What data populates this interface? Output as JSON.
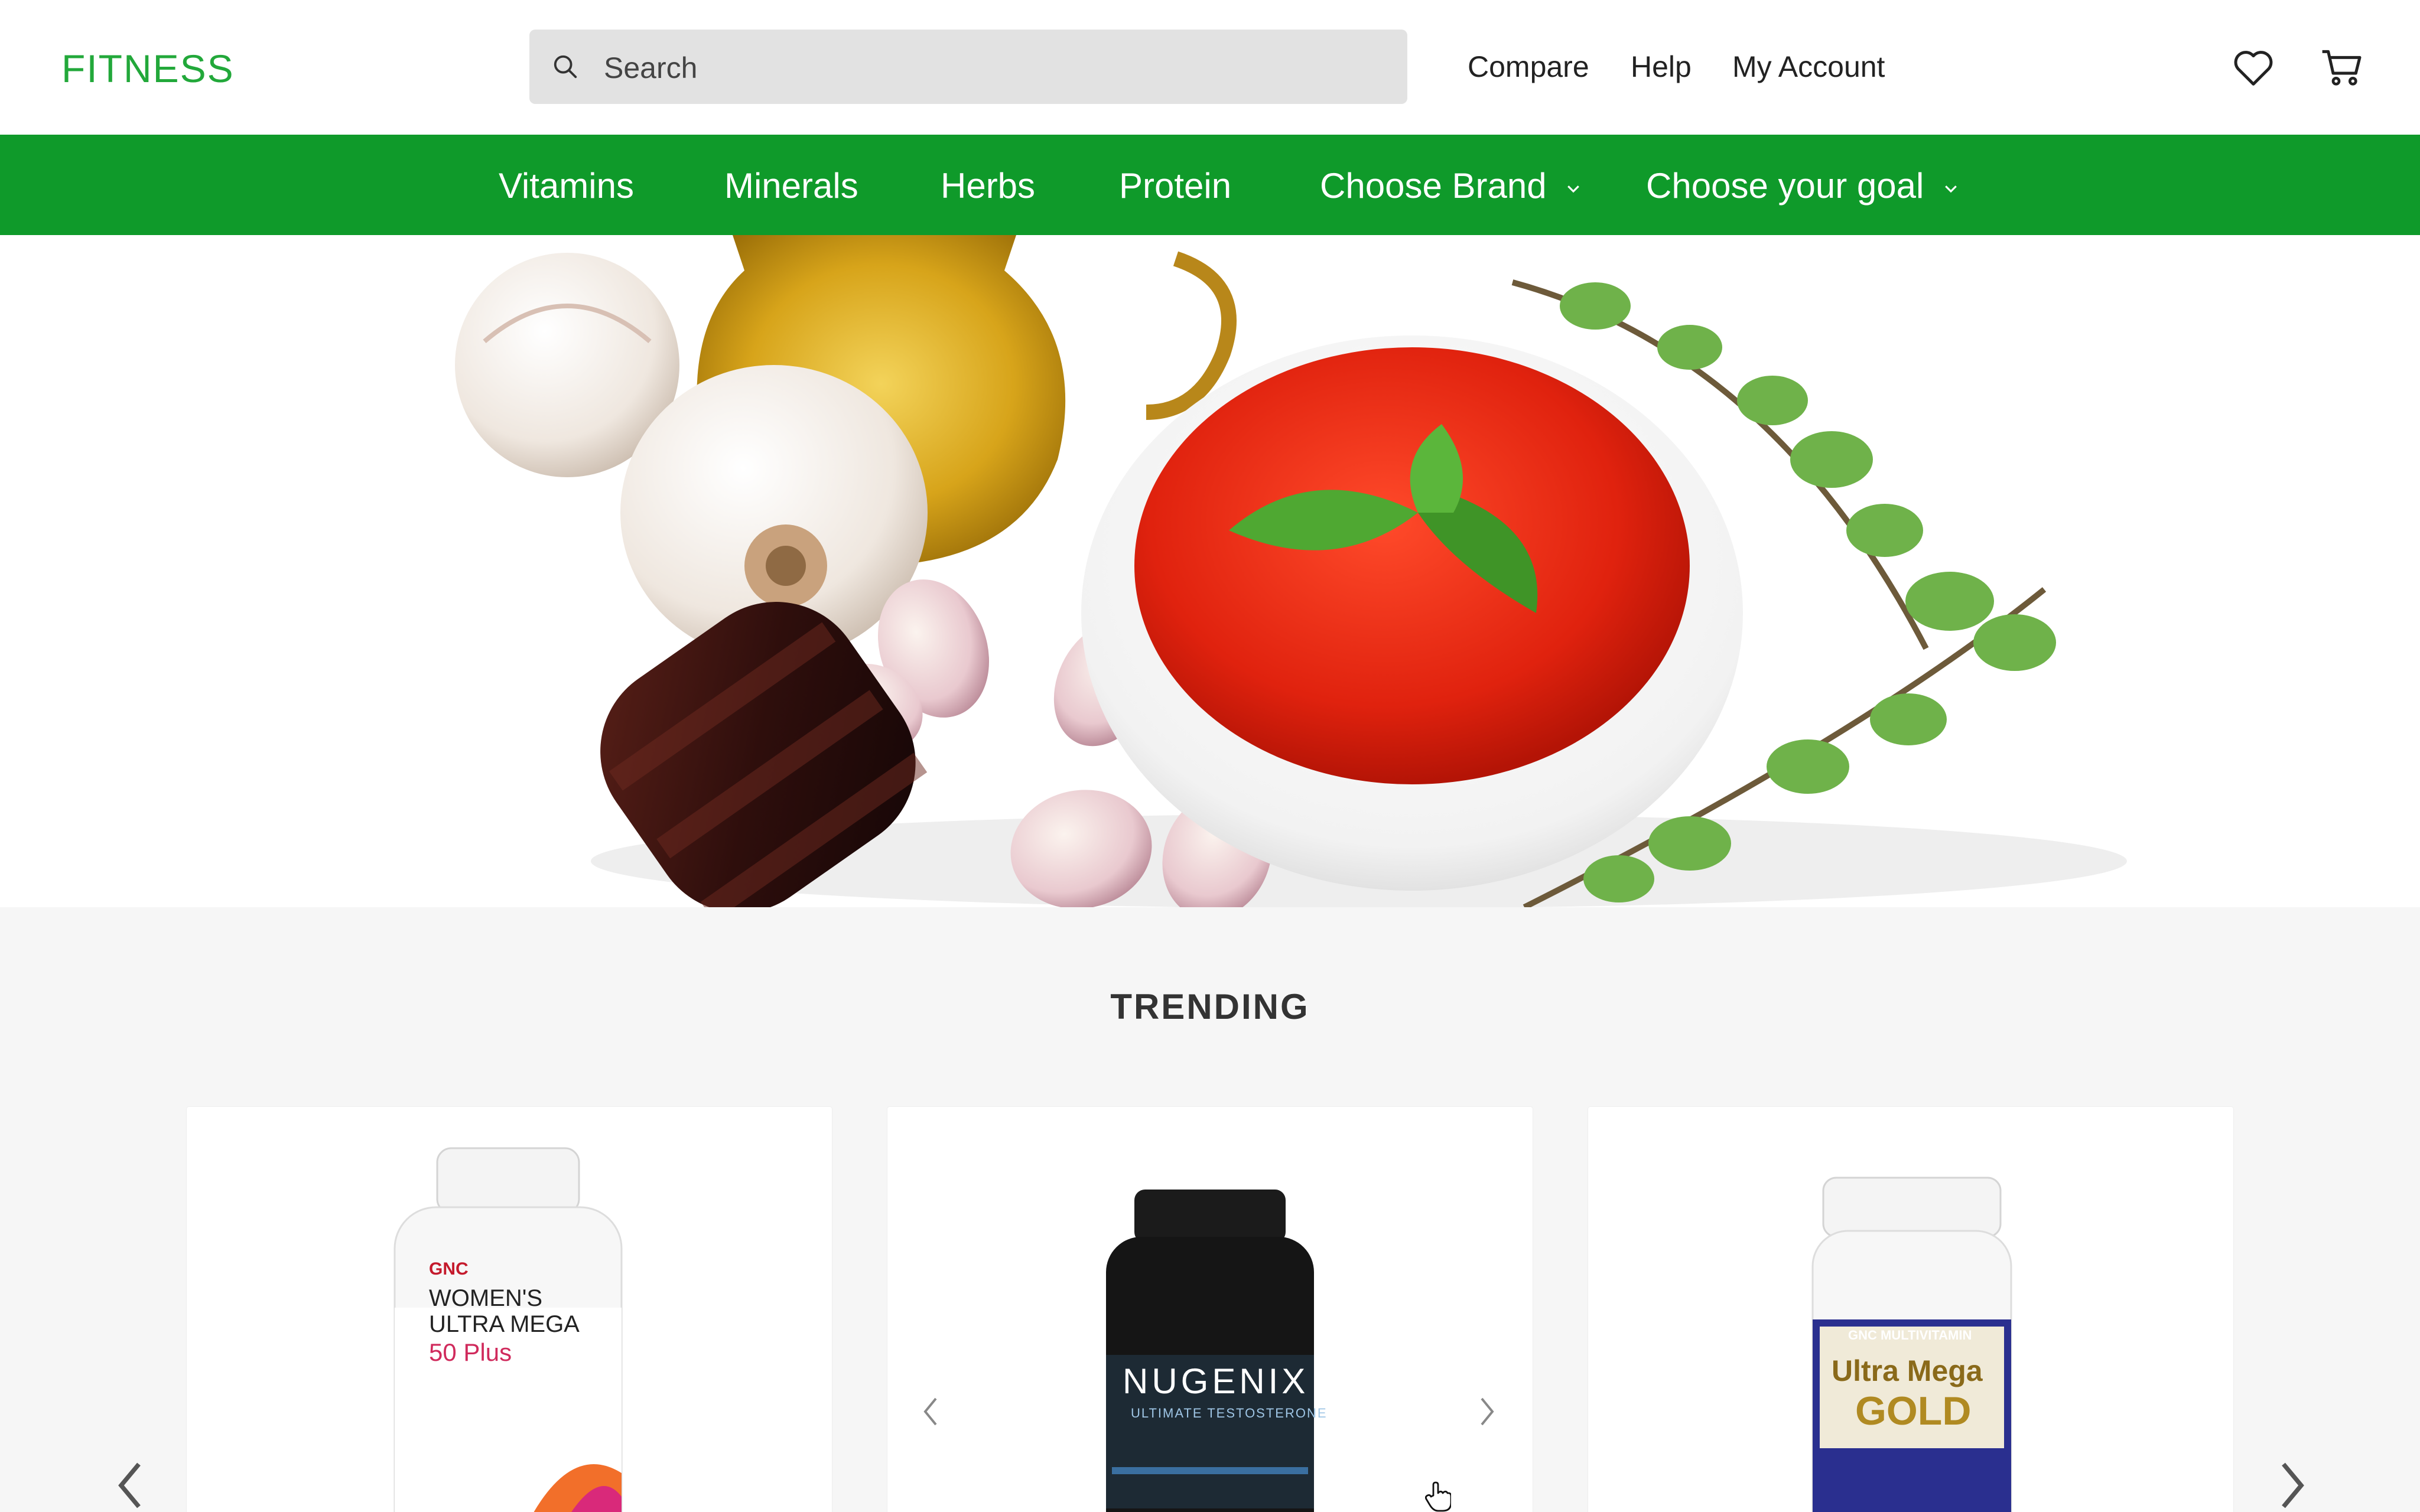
{
  "header": {
    "logo": "FITNESS",
    "search_placeholder": "Search",
    "links": [
      "Compare",
      "Help",
      "My Account"
    ],
    "icons": [
      "search-icon",
      "heart-icon",
      "cart-icon"
    ]
  },
  "nav": {
    "items": [
      "Vitamins",
      "Minerals",
      "Herbs",
      "Protein",
      "Choose Brand",
      "Choose your goal"
    ]
  },
  "trending": {
    "title": "TRENDING",
    "products": [
      {
        "brand": "GNC",
        "lines": [
          "WOMEN'S",
          "ULTRA MEGA",
          "50 Plus"
        ]
      },
      {
        "brand": "NUGENIX",
        "lines": [
          "ULTIMATE TESTOSTERONE"
        ]
      },
      {
        "brand": "GNC MULTIVITAMIN",
        "lines": [
          "Ultra Mega",
          "GOLD"
        ]
      }
    ]
  },
  "colors": {
    "brand_green": "#22a83a",
    "nav_green": "#0f9a2a",
    "search_bg": "#e2e2e2",
    "section_bg": "#f6f6f6"
  }
}
